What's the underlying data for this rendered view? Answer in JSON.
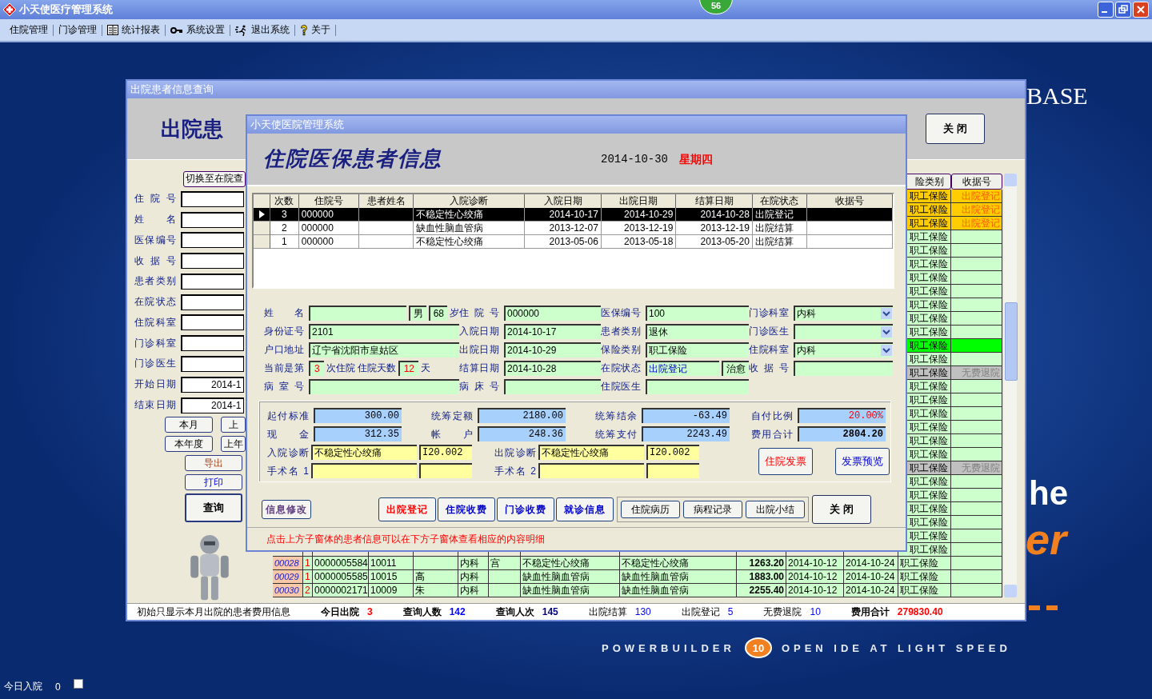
{
  "app": {
    "title": "小天使医疗管理系统",
    "badge": "56"
  },
  "menu": [
    {
      "label": "住院管理",
      "kind": "none"
    },
    {
      "label": "门诊管理",
      "kind": "none"
    },
    {
      "label": "统计报表",
      "kind": "table"
    },
    {
      "label": "系统设置",
      "kind": "key"
    },
    {
      "label": "退出系统",
      "kind": "exit"
    },
    {
      "label": "关于",
      "kind": "help"
    }
  ],
  "wallpaper": {
    "brand": "BASE",
    "word_1": "he",
    "word_2": "er",
    "slogan_left": "POWERBUILDER",
    "version": "10",
    "slogan_right": "OPEN IDE AT LIGHT SPEED"
  },
  "taskbar": {
    "label": "今日入院",
    "value": "0",
    "checked": false
  },
  "query_window": {
    "title": "出院患者信息查询",
    "heading": "出院患",
    "close": "关 闭",
    "switch_button": "切换至在院查",
    "fields": [
      {
        "label": "住院号"
      },
      {
        "label": "姓名"
      },
      {
        "label": "医保编号"
      },
      {
        "label": "收据号"
      },
      {
        "label": "患者类别"
      },
      {
        "label": "在院状态"
      },
      {
        "label": "住院科室"
      },
      {
        "label": "门诊科室"
      },
      {
        "label": "门诊医生"
      },
      {
        "label": "开始日期",
        "value": "2014-1"
      },
      {
        "label": "结束日期",
        "value": "2014-1"
      }
    ],
    "period_buttons": [
      [
        "本月",
        "上"
      ],
      [
        "本年度",
        "上年"
      ]
    ],
    "action_buttons": [
      {
        "label": "导出",
        "kind": "export"
      },
      {
        "label": "打印",
        "kind": "print"
      }
    ],
    "search_button": "查询",
    "grid": {
      "headers": {
        "insurance": "险类别",
        "receipt": "收据号"
      },
      "rows": [
        {
          "kind": "registered",
          "insurance": "职工保险",
          "receipt": "出院登记"
        },
        {
          "kind": "registered",
          "insurance": "职工保险",
          "receipt": "出院登记"
        },
        {
          "kind": "registered",
          "insurance": "职工保险",
          "receipt": "出院登记"
        },
        {
          "kind": "normal",
          "insurance": "职工保险"
        },
        {
          "kind": "normal",
          "insurance": "职工保险"
        },
        {
          "kind": "normal",
          "insurance": "职工保险"
        },
        {
          "kind": "normal",
          "insurance": "职工保险"
        },
        {
          "kind": "normal",
          "insurance": "职工保险"
        },
        {
          "kind": "normal",
          "insurance": "职工保险"
        },
        {
          "kind": "normal",
          "insurance": "职工保险"
        },
        {
          "kind": "normal",
          "insurance": "职工保险"
        },
        {
          "kind": "current",
          "insurance": "职工保险"
        },
        {
          "kind": "normal",
          "insurance": "职工保险"
        },
        {
          "kind": "refund",
          "insurance": "职工保险",
          "receipt": "无费退院"
        },
        {
          "kind": "normal",
          "insurance": "职工保险"
        },
        {
          "kind": "normal",
          "insurance": "职工保险"
        },
        {
          "kind": "normal",
          "insurance": "职工保险"
        },
        {
          "kind": "normal",
          "insurance": "职工保险"
        },
        {
          "kind": "normal",
          "insurance": "职工保险"
        },
        {
          "kind": "normal",
          "insurance": "职工保险"
        },
        {
          "kind": "refund",
          "insurance": "职工保险",
          "receipt": "无费退院"
        },
        {
          "kind": "normal",
          "insurance": "职工保险"
        },
        {
          "kind": "normal",
          "insurance": "职工保险"
        },
        {
          "kind": "normal",
          "insurance": "职工保险"
        },
        {
          "kind": "normal",
          "insurance": "职工保险"
        },
        {
          "kind": "normal",
          "insurance": "职工保险"
        },
        {
          "kind": "normal",
          "insurance": "职工保险"
        },
        {
          "kind": "normal",
          "no": "00028",
          "times": "1",
          "inpatient_no": "0000005584",
          "medical_no": "10011",
          "dept": "内科",
          "doctor": "宫",
          "admit_diag": "不稳定性心绞痛",
          "discharge_diag": "不稳定性心绞痛",
          "total": "1263.20",
          "admit_date": "2014-10-12",
          "discharge_date": "2014-10-24",
          "insurance": "职工保险"
        },
        {
          "kind": "normal",
          "no": "00029",
          "times": "1",
          "inpatient_no": "0000005585",
          "medical_no": "10015",
          "name": "高",
          "dept": "内科",
          "admit_diag": "缺血性脑血管病",
          "discharge_diag": "缺血性脑血管病",
          "total": "1883.00",
          "admit_date": "2014-10-12",
          "discharge_date": "2014-10-24",
          "insurance": "职工保险"
        },
        {
          "kind": "normal",
          "no": "00030",
          "times": "2",
          "inpatient_no": "0000002171",
          "medical_no": "10009",
          "name": "朱",
          "dept": "内科",
          "admit_diag": "缺血性脑血管病",
          "discharge_diag": "缺血性脑血管病",
          "total": "2255.40",
          "admit_date": "2014-10-12",
          "discharge_date": "2014-10-24",
          "insurance": "职工保险"
        }
      ]
    },
    "status_bar": [
      {
        "label": "初始只显示本月出院的患者费用信息",
        "emphasis": false
      },
      {
        "label": "今日出院",
        "value": "3",
        "color": "#ff0000",
        "emphasis": true
      },
      {
        "label": "查询人数",
        "value": "142",
        "color": "#0000ff",
        "emphasis": true
      },
      {
        "label": "查询人次",
        "value": "145",
        "color": "#000080",
        "emphasis": true
      },
      {
        "label": "出院结算",
        "value": "130",
        "color": "#0000ff",
        "emphasis": false
      },
      {
        "label": "出院登记",
        "value": "5",
        "color": "#0000ff",
        "emphasis": false
      },
      {
        "label": "无费退院",
        "value": "10",
        "color": "#0000ff",
        "emphasis": false
      },
      {
        "label": "费用合计",
        "value": "279830.40",
        "color": "#ff0000",
        "emphasis": true
      }
    ]
  },
  "info_window": {
    "title": "小天使医院管理系统",
    "heading": "住院医保患者信息",
    "date": "2014-10-30",
    "weekday": "星期四",
    "table": {
      "columns": [
        "次数",
        "住院号",
        "患者姓名",
        "入院诊断",
        "入院日期",
        "出院日期",
        "结算日期",
        "在院状态",
        "收据号"
      ],
      "rows": [
        {
          "selected": true,
          "cells": [
            "3",
            "000000",
            "",
            "不稳定性心绞痛",
            "2014-10-17",
            "2014-10-29",
            "2014-10-28",
            "出院登记",
            ""
          ]
        },
        {
          "selected": false,
          "cells": [
            "2",
            "000000",
            "",
            "缺血性脑血管病",
            "2013-12-07",
            "2013-12-19",
            "2013-12-19",
            "出院结算",
            ""
          ]
        },
        {
          "selected": false,
          "cells": [
            "1",
            "000000",
            "",
            "不稳定性心绞痛",
            "2013-05-06",
            "2013-05-18",
            "2013-05-20",
            "出院结算",
            ""
          ]
        }
      ]
    },
    "form": [
      [
        {
          "label": "姓名",
          "parts": [
            {
              "kind": "field"
            },
            {
              "kind": "short",
              "text": "男"
            },
            {
              "kind": "short",
              "text": "68"
            },
            {
              "kind": "unit",
              "text": "岁"
            }
          ]
        },
        {
          "label": "住院号",
          "parts": [
            {
              "kind": "field",
              "text": "000000"
            }
          ]
        },
        {
          "label": "医保编号",
          "parts": [
            {
              "kind": "field",
              "text": "100"
            }
          ]
        },
        {
          "label": "门诊科室",
          "parts": [
            {
              "kind": "dropdown",
              "text": "内科"
            }
          ]
        }
      ],
      [
        {
          "label": "身份证号",
          "parts": [
            {
              "kind": "field",
              "text": "2101"
            }
          ]
        },
        {
          "label": "入院日期",
          "parts": [
            {
              "kind": "field",
              "text": "2014-10-17"
            }
          ]
        },
        {
          "label": "患者类别",
          "parts": [
            {
              "kind": "field",
              "text": "退休"
            }
          ]
        },
        {
          "label": "门诊医生",
          "parts": [
            {
              "kind": "dropdown"
            }
          ]
        }
      ],
      [
        {
          "label": "户口地址",
          "parts": [
            {
              "kind": "field",
              "text": "辽宁省沈阳市皇姑区"
            }
          ]
        },
        {
          "label": "出院日期",
          "parts": [
            {
              "kind": "field",
              "text": "2014-10-29"
            }
          ]
        },
        {
          "label": "保险类别",
          "parts": [
            {
              "kind": "field",
              "text": "职工保险"
            }
          ]
        },
        {
          "label": "住院科室",
          "parts": [
            {
              "kind": "dropdown",
              "text": "内科"
            }
          ]
        }
      ],
      [
        {
          "label": "当前是第",
          "parts": [
            {
              "kind": "count",
              "text": "3"
            },
            {
              "kind": "unit",
              "text": "次住院"
            },
            {
              "kind": "unit",
              "text": "住院天数"
            },
            {
              "kind": "count",
              "text": "12"
            },
            {
              "kind": "unit",
              "text": "天"
            }
          ]
        },
        {
          "label": "结算日期",
          "parts": [
            {
              "kind": "field",
              "text": "2014-10-28"
            }
          ]
        },
        {
          "label": "在院状态",
          "parts": [
            {
              "kind": "status",
              "text": "出院登记"
            },
            {
              "kind": "short",
              "text": "治愈"
            }
          ]
        },
        {
          "label": "收据号",
          "parts": [
            {
              "kind": "field"
            }
          ]
        }
      ],
      [
        {
          "label": "病室号",
          "parts": [
            {
              "kind": "field"
            }
          ]
        },
        {
          "label": "病床号",
          "parts": [
            {
              "kind": "field"
            }
          ]
        },
        {
          "label": "住院医生",
          "parts": [
            {
              "kind": "field"
            }
          ]
        }
      ]
    ],
    "money": [
      {
        "label": "起付标准",
        "value": "300.00",
        "kind": "plain"
      },
      {
        "label": "统筹定额",
        "value": "2180.00",
        "kind": "plain"
      },
      {
        "label": "统筹结余",
        "value": "-63.49",
        "kind": "plain"
      },
      {
        "label": "自付比例",
        "value": "20.00%",
        "kind": "alert"
      },
      {
        "label": "现金",
        "value": "312.35",
        "kind": "plain"
      },
      {
        "label": "帐户",
        "value": "248.36",
        "kind": "plain"
      },
      {
        "label": "统筹支付",
        "value": "2243.49",
        "kind": "plain"
      },
      {
        "label": "费用合计",
        "value": "2804.20",
        "kind": "total"
      }
    ],
    "diagnoses": [
      {
        "label": "入院诊断",
        "name": "不稳定性心绞痛",
        "code": "I20.002"
      },
      {
        "label": "出院诊断",
        "name": "不稳定性心绞痛",
        "code": "I20.002"
      },
      {
        "label": "手术名 1"
      },
      {
        "label": "手术名 2"
      }
    ],
    "invoice_buttons": [
      {
        "label": "住院发票",
        "kind": "issue"
      },
      {
        "label": "发票预览",
        "kind": "preview"
      }
    ],
    "edit_button": {
      "label": "信息修改",
      "color": "#604080"
    },
    "main_buttons": [
      {
        "label": "出院登记",
        "color": "#ff0000"
      },
      {
        "label": "住院收费",
        "color": "#0000cc"
      },
      {
        "label": "门诊收费",
        "color": "#0000cc"
      },
      {
        "label": "就诊信息",
        "color": "#0000cc"
      }
    ],
    "record_buttons": [
      "住院病历",
      "病程记录",
      "出院小结"
    ],
    "close": "关 闭",
    "hint": "点击上方子窗体的患者信息可以在下方子窗体查看相应的内容明细"
  }
}
